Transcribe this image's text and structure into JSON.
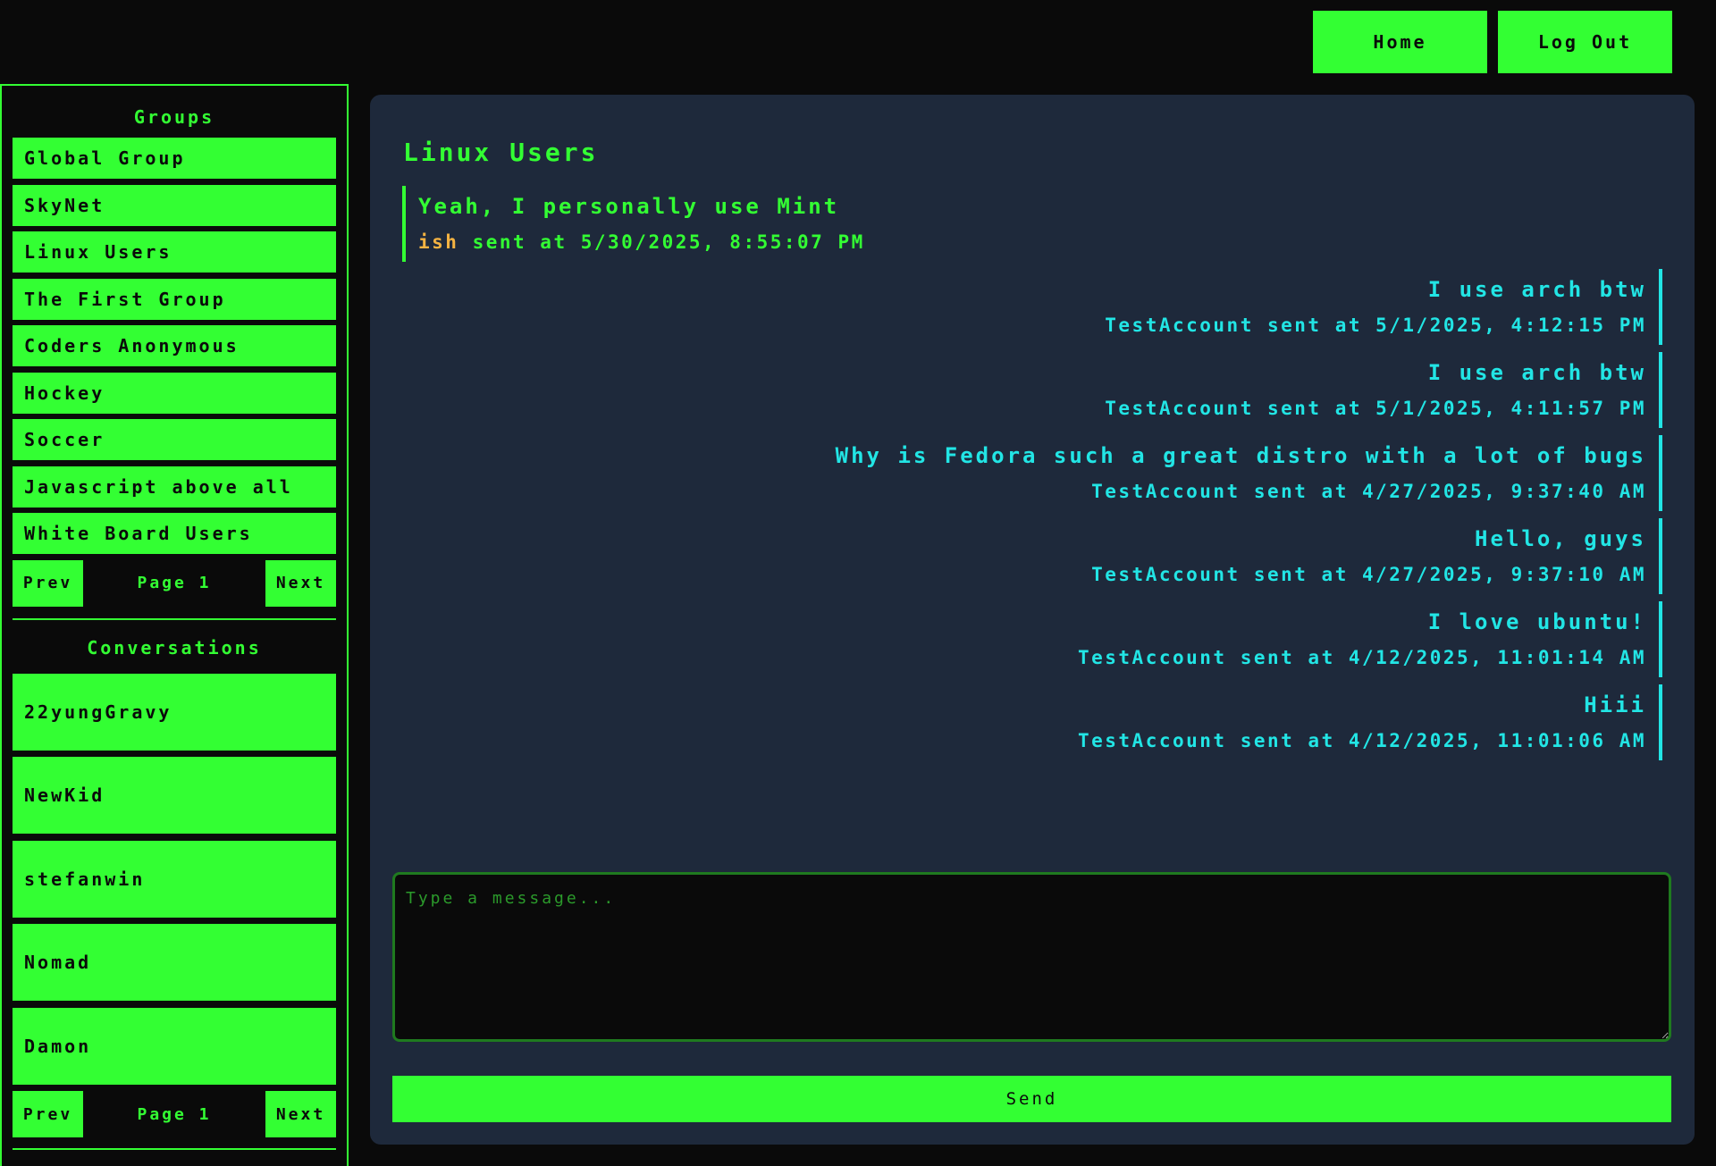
{
  "nav": {
    "home_label": "Home",
    "logout_label": "Log Out"
  },
  "sidebar": {
    "groups_title": "Groups",
    "groups": [
      "Global Group",
      "SkyNet",
      "Linux Users",
      "The First Group",
      "Coders Anonymous",
      "Hockey",
      "Soccer",
      "Javascript above all",
      "White Board Users"
    ],
    "groups_pager": {
      "prev": "Prev",
      "page": "Page 1",
      "next": "Next"
    },
    "conversations_title": "Conversations",
    "conversations": [
      "22yungGravy",
      "NewKid",
      "stefanwin",
      "Nomad",
      "Damon"
    ],
    "conversations_pager": {
      "prev": "Prev",
      "page": "Page 1",
      "next": "Next"
    }
  },
  "chat": {
    "title": "Linux Users",
    "messages": [
      {
        "side": "left",
        "text": "Yeah, I personally use Mint",
        "sender": "ish",
        "meta": " sent at 5/30/2025, 8:55:07 PM"
      },
      {
        "side": "right",
        "text": "I use arch btw",
        "sender": "TestAccount",
        "meta": " sent at 5/1/2025, 4:12:15 PM"
      },
      {
        "side": "right",
        "text": "I use arch btw",
        "sender": "TestAccount",
        "meta": " sent at 5/1/2025, 4:11:57 PM"
      },
      {
        "side": "right",
        "text": "Why is Fedora such a great distro with a lot of bugs",
        "sender": "TestAccount",
        "meta": " sent at 4/27/2025, 9:37:40 AM"
      },
      {
        "side": "right",
        "text": "Hello, guys",
        "sender": "TestAccount",
        "meta": " sent at 4/27/2025, 9:37:10 AM"
      },
      {
        "side": "right",
        "text": "I love ubuntu!",
        "sender": "TestAccount",
        "meta": " sent at 4/12/2025, 11:01:14 AM"
      },
      {
        "side": "right",
        "text": "Hiii",
        "sender": "TestAccount",
        "meta": " sent at 4/12/2025, 11:01:06 AM"
      }
    ],
    "composer_placeholder": "Type a message...",
    "composer_value": "",
    "send_label": "Send"
  },
  "colors": {
    "accent": "#33ff33",
    "background": "#0a0a0a",
    "panel": "#1e293b",
    "other_user": "#22e5e5",
    "sender_highlight": "#f5b342"
  }
}
